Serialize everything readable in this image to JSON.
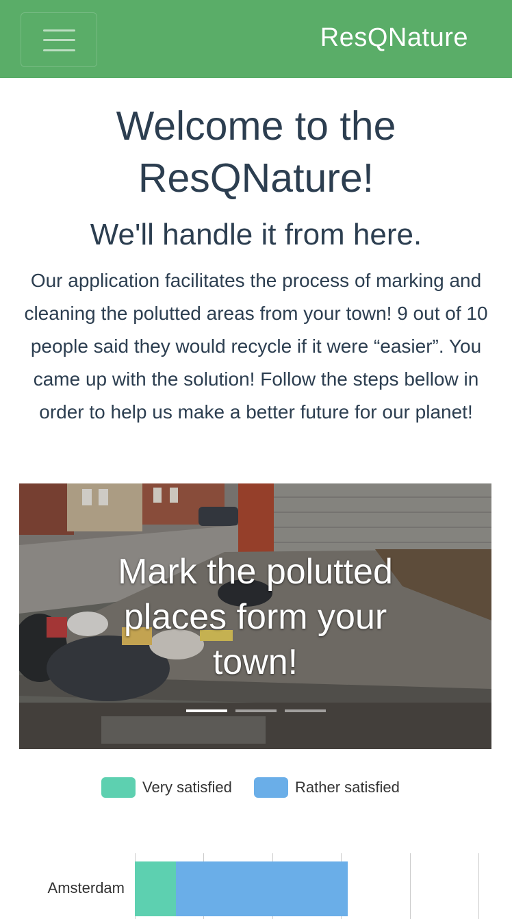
{
  "navbar": {
    "brand": "ResQNature",
    "menu_icon": "hamburger-menu-icon"
  },
  "hero": {
    "title": "Welcome to the ResQNature!",
    "subtitle": "We'll handle it from here.",
    "text": "Our application facilitates the process of marking and cleaning the polutted areas from your town! 9 out of 10 people said they would recycle if it were “easier”. You came up with the solution! Follow the steps bellow in order to help us make a better future for our planet!"
  },
  "carousel": {
    "caption": "Mark the polutted places form your town!",
    "slide_count": 3,
    "active_slide": 1
  },
  "colors": {
    "navbar": "#5aad68",
    "very_satisfied": "#5dd0b0",
    "rather_satisfied": "#6aaee8"
  },
  "chart_data": {
    "type": "bar",
    "orientation": "horizontal",
    "stacked": true,
    "categories": [
      "Amsterdam"
    ],
    "series": [
      {
        "name": "Very satisfied",
        "values": [
          30
        ]
      },
      {
        "name": "Rather satisfied",
        "values": [
          125
        ]
      }
    ],
    "xlim": [
      0,
      250
    ],
    "grid": true,
    "legend_position": "top"
  }
}
